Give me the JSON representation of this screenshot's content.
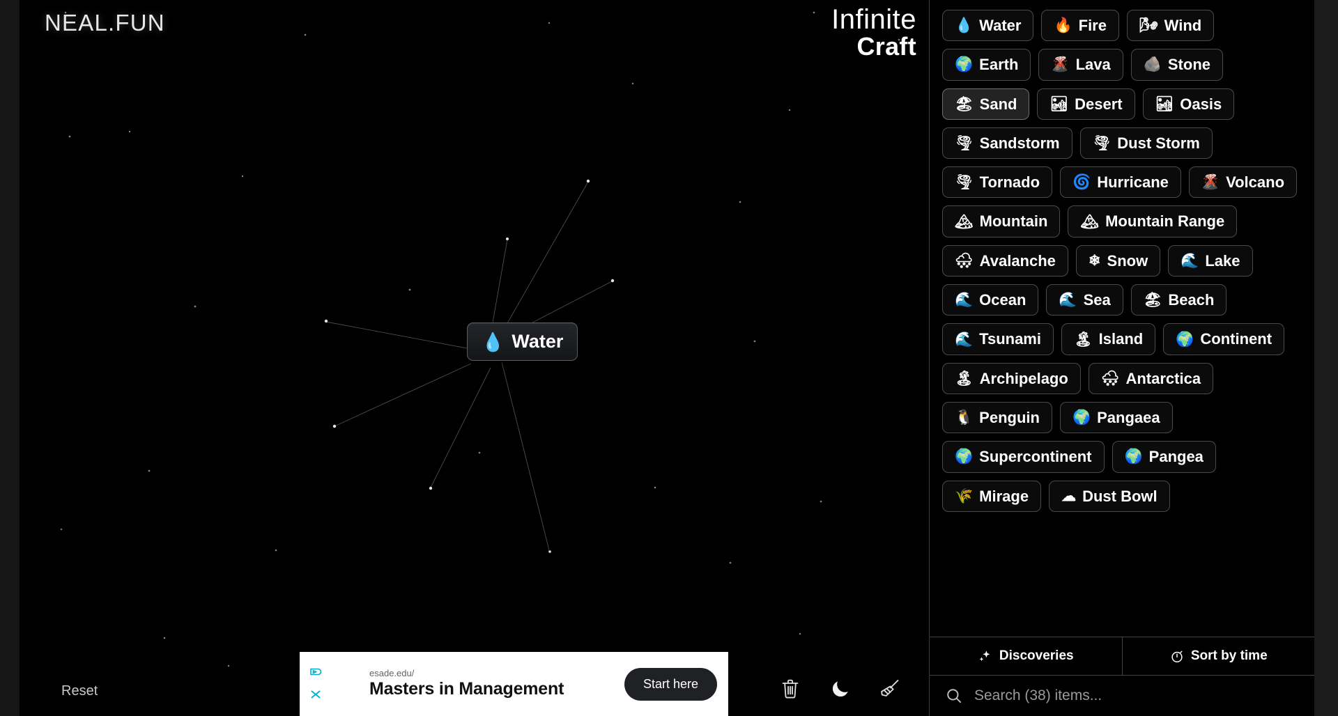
{
  "brand": "NEAL.FUN",
  "game_title": {
    "line1": "Infinite",
    "line2": "Craft"
  },
  "canvas": {
    "card": {
      "emoji": "💧",
      "label": "Water"
    },
    "reset_label": "Reset"
  },
  "toolbar": {
    "items": [
      {
        "name": "trash-icon",
        "title": "Delete"
      },
      {
        "name": "moon-icon",
        "title": "Dark mode"
      },
      {
        "name": "broom-icon",
        "title": "Clear board"
      },
      {
        "name": "speaker-icon",
        "title": "Sound"
      }
    ]
  },
  "ad": {
    "url": "esade.edu/",
    "headline": "Masters in Management",
    "cta": "Start here"
  },
  "sidebar": {
    "items": [
      {
        "emoji": "💧",
        "label": "Water",
        "hovered": false
      },
      {
        "emoji": "🔥",
        "label": "Fire",
        "hovered": false
      },
      {
        "emoji": "🌬",
        "label": "Wind",
        "hovered": false
      },
      {
        "emoji": "🌍",
        "label": "Earth",
        "hovered": false
      },
      {
        "emoji": "🌋",
        "label": "Lava",
        "hovered": false
      },
      {
        "emoji": "🪨",
        "label": "Stone",
        "hovered": false
      },
      {
        "emoji": "🏖",
        "label": "Sand",
        "hovered": true
      },
      {
        "emoji": "🏜",
        "label": "Desert",
        "hovered": false
      },
      {
        "emoji": "🏜",
        "label": "Oasis",
        "hovered": false
      },
      {
        "emoji": "🌪",
        "label": "Sandstorm",
        "hovered": false
      },
      {
        "emoji": "🌪",
        "label": "Dust Storm",
        "hovered": false
      },
      {
        "emoji": "🌪",
        "label": "Tornado",
        "hovered": false
      },
      {
        "emoji": "🌀",
        "label": "Hurricane",
        "hovered": false
      },
      {
        "emoji": "🌋",
        "label": "Volcano",
        "hovered": false
      },
      {
        "emoji": "🏔",
        "label": "Mountain",
        "hovered": false
      },
      {
        "emoji": "🏔",
        "label": "Mountain Range",
        "hovered": false
      },
      {
        "emoji": "🌨",
        "label": "Avalanche",
        "hovered": false
      },
      {
        "emoji": "❄",
        "label": "Snow",
        "hovered": false
      },
      {
        "emoji": "🌊",
        "label": "Lake",
        "hovered": false
      },
      {
        "emoji": "🌊",
        "label": "Ocean",
        "hovered": false
      },
      {
        "emoji": "🌊",
        "label": "Sea",
        "hovered": false
      },
      {
        "emoji": "🏖",
        "label": "Beach",
        "hovered": false
      },
      {
        "emoji": "🌊",
        "label": "Tsunami",
        "hovered": false
      },
      {
        "emoji": "🏝",
        "label": "Island",
        "hovered": false
      },
      {
        "emoji": "🌍",
        "label": "Continent",
        "hovered": false
      },
      {
        "emoji": "🏝",
        "label": "Archipelago",
        "hovered": false
      },
      {
        "emoji": "🌨",
        "label": "Antarctica",
        "hovered": false
      },
      {
        "emoji": "🐧",
        "label": "Penguin",
        "hovered": false
      },
      {
        "emoji": "🌍",
        "label": "Pangaea",
        "hovered": false
      },
      {
        "emoji": "🌍",
        "label": "Supercontinent",
        "hovered": false
      },
      {
        "emoji": "🌍",
        "label": "Pangea",
        "hovered": false
      },
      {
        "emoji": "🌾",
        "label": "Mirage",
        "hovered": false
      },
      {
        "emoji": "☁",
        "label": "Dust Bowl",
        "hovered": false
      }
    ],
    "tabs": [
      {
        "icon": "sparkles-icon",
        "label": "Discoveries"
      },
      {
        "icon": "stopwatch-icon",
        "label": "Sort by time"
      }
    ],
    "search": {
      "placeholder": "Search (38) items...",
      "value": "",
      "count": 38
    }
  }
}
